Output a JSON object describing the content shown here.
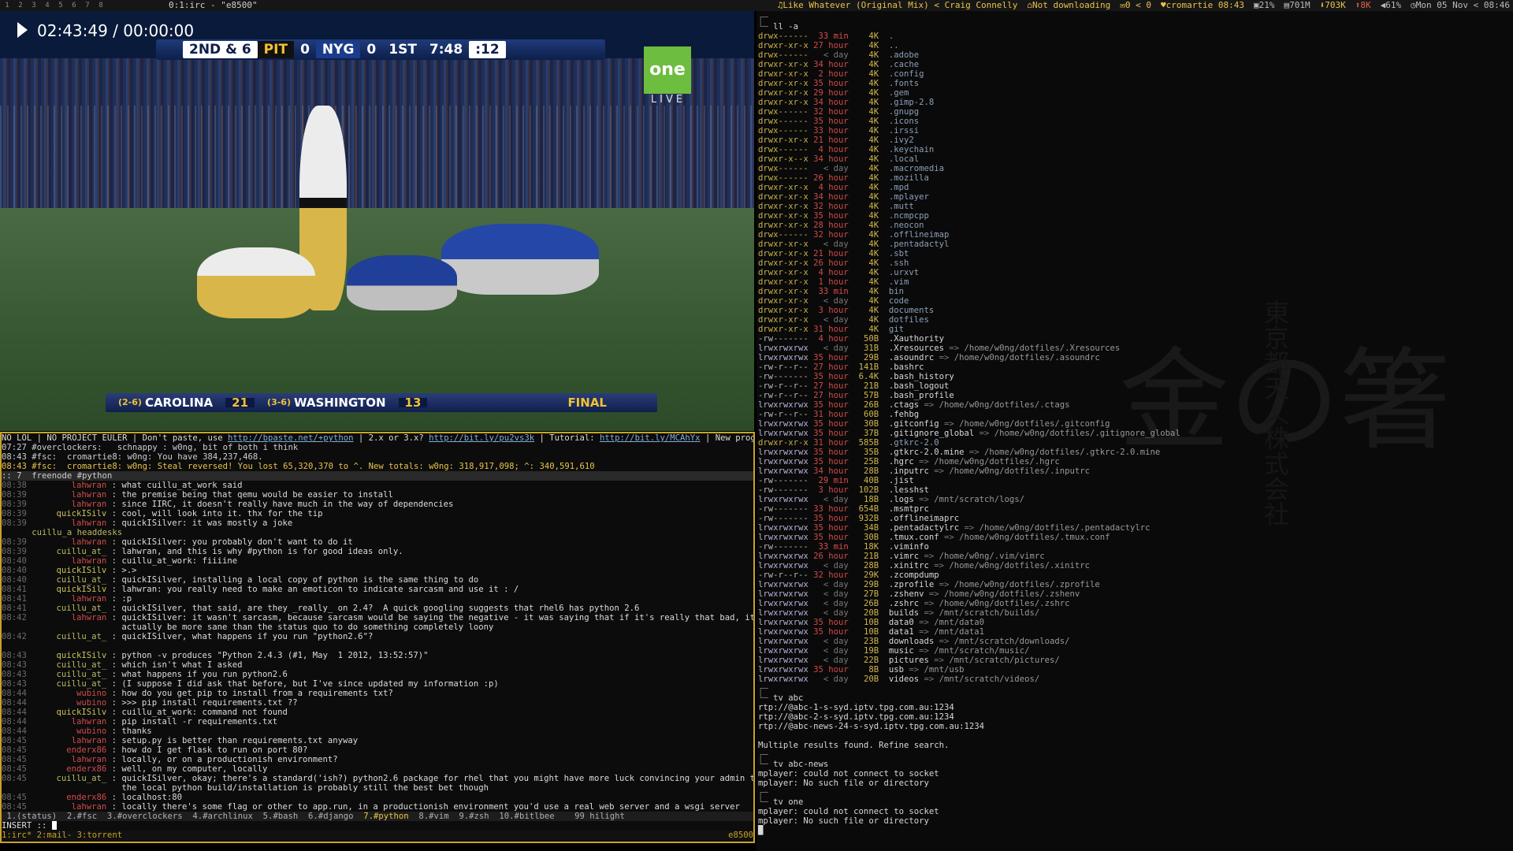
{
  "topbar": {
    "workspaces": [
      "1",
      "2",
      "3",
      "4",
      "5",
      "6",
      "7",
      "8"
    ],
    "title": "0:1:irc - \"e8500\"",
    "music": "Like Whatever (Original Mix) < Craig Connelly",
    "torrent": "Not downloading",
    "mail": "0 < 0",
    "host": "cromartie",
    "time_small": "08:43",
    "cpu": "21%",
    "mem": "701M",
    "down": "703K",
    "up": "8K",
    "vol": "61%",
    "date": "Mon 05 Nov < 08:46"
  },
  "video": {
    "osd_time": "02:43:49 / 00:00:00",
    "scorebug": {
      "down": "2ND & 6",
      "team1": "PIT",
      "score1": "0",
      "team2": "NYG",
      "score2": "0",
      "quarter": "1ST",
      "clock": "7:48",
      "playclock": ":12"
    },
    "network": "one",
    "network_sub": "LIVE",
    "ticker": {
      "rec1": "(2-6)",
      "team1": "CAROLINA",
      "score1": "21",
      "rec2": "(3-6)",
      "team2": "WASHINGTON",
      "score2": "13",
      "status": "FINAL"
    }
  },
  "irc": {
    "topic_pre": "NO LOL | NO PROJECT EULER | Don't paste, use ",
    "topic_link1": "http://bpaste.net/+python",
    "topic_mid": " | 2.x or 3.x? ",
    "topic_link2": "http://bit.ly/pu2vs3k",
    "topic_mid2": " | Tutorial: ",
    "topic_link3": "http://bit.ly/MCAhYx",
    "topic_post": " | New programmer?",
    "status_lines": [
      "07:27 #overclockers:   schnappy : w0ng, bit of both i think",
      "08:43 #fsc:  cromartie8: w0ng: You have 384,237,468.",
      "08:43 #fsc:  cromartie8: w0ng: Steal reversed! You lost 65,320,370 to ^. New totals: w0ng: 318,917,098; ^: 340,591,610"
    ],
    "channel_header": ":: 7  freenode #python",
    "messages": [
      {
        "t": "08:38",
        "nick": "lahwran",
        "c": "n-r",
        "msg": "what cuillu_at_work said"
      },
      {
        "t": "08:39",
        "nick": "lahwran",
        "c": "n-r",
        "msg": "the premise being that qemu would be easier to install"
      },
      {
        "t": "08:39",
        "nick": "lahwran",
        "c": "n-r",
        "msg": "since IIRC, it doesn't really have much in the way of dependencies"
      },
      {
        "t": "08:39",
        "nick": "quickISilv",
        "c": "n-g",
        "msg": "cool, will look into it. thx for the tip"
      },
      {
        "t": "08:39",
        "nick": "lahwran",
        "c": "n-r",
        "msg": "quickISilver: it was mostly a joke"
      },
      {
        "t": "",
        "nick": "cuillu_a headdesks",
        "c": "n-c",
        "msg": "",
        "action": true
      },
      {
        "t": "08:39",
        "nick": "lahwran",
        "c": "n-r",
        "msg": "quickISilver: you probably don't want to do it"
      },
      {
        "t": "08:39",
        "nick": "cuillu_at_",
        "c": "n-c",
        "msg": "lahwran, and this is why #python is for good ideas only."
      },
      {
        "t": "08:40",
        "nick": "lahwran",
        "c": "n-r",
        "msg": "cuillu_at_work: fiiiine"
      },
      {
        "t": "08:40",
        "nick": "quickISilv",
        "c": "n-g",
        "msg": ">.>"
      },
      {
        "t": "08:40",
        "nick": "cuillu_at_",
        "c": "n-c",
        "msg": "quickISilver, installing a local copy of python is the same thing to do"
      },
      {
        "t": "08:41",
        "nick": "quickISilv",
        "c": "n-g",
        "msg": "lahwran: you really need to make an emoticon to indicate sarcasm and use it : /"
      },
      {
        "t": "08:41",
        "nick": "lahwran",
        "c": "n-r",
        "msg": ":p"
      },
      {
        "t": "08:41",
        "nick": "cuillu_at_",
        "c": "n-c",
        "msg": "quickISilver, that said, are they _really_ on 2.4?  A quick googling suggests that rhel6 has python 2.6"
      },
      {
        "t": "08:42",
        "nick": "lahwran",
        "c": "n-r",
        "msg": "quickISilver: it wasn't sarcasm, because sarcasm would be saying the negative - it was saying that if it's really that bad, it might"
      },
      {
        "t": "",
        "nick": "",
        "c": "n-b",
        "msg": "actually be more sane than the status quo to do something completely loony"
      },
      {
        "t": "08:42",
        "nick": "cuillu_at_",
        "c": "n-c",
        "msg": "quickISilver, what happens if you run \"python2.6\"?"
      },
      {
        "t": "",
        "nick": "",
        "c": "n-b",
        "msg": ""
      },
      {
        "t": "08:43",
        "nick": "quickISilv",
        "c": "n-g",
        "msg": "python -v produces \"Python 2.4.3 (#1, May  1 2012, 13:52:57)\""
      },
      {
        "t": "08:43",
        "nick": "cuillu_at_",
        "c": "n-c",
        "msg": "which isn't what I asked"
      },
      {
        "t": "08:43",
        "nick": "cuillu_at_",
        "c": "n-c",
        "msg": "what happens if you run python2.6"
      },
      {
        "t": "08:43",
        "nick": "cuillu_at_",
        "c": "n-c",
        "msg": "(I suppose I did ask that before, but I've since updated my information :p)"
      },
      {
        "t": "08:44",
        "nick": "wubino",
        "c": "n-r",
        "msg": "how do you get pip to install from a requirements txt?"
      },
      {
        "t": "08:44",
        "nick": "wubino",
        "c": "n-r",
        "msg": ">>> pip install requirements.txt ??"
      },
      {
        "t": "08:44",
        "nick": "quickISilv",
        "c": "n-g",
        "msg": "cuillu_at_work: command not found"
      },
      {
        "t": "08:44",
        "nick": "lahwran",
        "c": "n-r",
        "msg": "pip install -r requirements.txt"
      },
      {
        "t": "08:44",
        "nick": "wubino",
        "c": "n-r",
        "msg": "thanks"
      },
      {
        "t": "08:45",
        "nick": "lahwran",
        "c": "n-r",
        "msg": "setup.py is better than requirements.txt anyway"
      },
      {
        "t": "08:45",
        "nick": "enderx86",
        "c": "n-r",
        "msg": "how do I get flask to run on port 80?"
      },
      {
        "t": "08:45",
        "nick": "lahwran",
        "c": "n-r",
        "msg": "locally, or on a productionish environment?"
      },
      {
        "t": "08:45",
        "nick": "enderx86",
        "c": "n-r",
        "msg": "well, on my computer, locally"
      },
      {
        "t": "08:45",
        "nick": "cuillu_at_",
        "c": "n-c",
        "msg": "quickISilver, okay; there's a standard('ish?) python2.6 package for rhel that you might have more luck convincing your admin to install;"
      },
      {
        "t": "",
        "nick": "",
        "c": "n-b",
        "msg": "the local python build/installation is probably still the best bet though"
      },
      {
        "t": "08:45",
        "nick": "enderx86",
        "c": "n-r",
        "msg": "localhost:80"
      },
      {
        "t": "08:45",
        "nick": "lahwran",
        "c": "n-r",
        "msg": "locally there's some flag or other to app.run, in a productionish environment you'd use a real web server and a wsgi server"
      }
    ],
    "windows_pre": " 1.(status)  2.#fsc  3.#overclockers  4.#archlinux  5.#bash  6.#django  ",
    "windows_active": "7.#python",
    "windows_post": "  8.#vim  9.#zsh  10.#bitlbee    99 hilight",
    "input_mode": "INSERT :: ",
    "tmux_left": "1:irc* 2:mail- 3:torrent",
    "tmux_right": "e8500"
  },
  "terminal": {
    "prompt_cmd": "ll -a",
    "listing": [
      [
        "drwx------",
        "33 min",
        "4K",
        "."
      ],
      [
        "drwxr-xr-x",
        "27 hour",
        "4K",
        ".."
      ],
      [
        "drwx------",
        "< day",
        "4K",
        ".adobe"
      ],
      [
        "drwxr-xr-x",
        "34 hour",
        "4K",
        ".cache"
      ],
      [
        "drwxr-xr-x",
        "2 hour",
        "4K",
        ".config"
      ],
      [
        "drwxr-xr-x",
        "35 hour",
        "4K",
        ".fonts"
      ],
      [
        "drwxr-xr-x",
        "29 hour",
        "4K",
        ".gem"
      ],
      [
        "drwxr-xr-x",
        "34 hour",
        "4K",
        ".gimp-2.8"
      ],
      [
        "drwx------",
        "32 hour",
        "4K",
        ".gnupg"
      ],
      [
        "drwx------",
        "35 hour",
        "4K",
        ".icons"
      ],
      [
        "drwx------",
        "33 hour",
        "4K",
        ".irssi"
      ],
      [
        "drwxr-xr-x",
        "21 hour",
        "4K",
        ".ivy2"
      ],
      [
        "drwx------",
        "4 hour",
        "4K",
        ".keychain"
      ],
      [
        "drwxr-x--x",
        "34 hour",
        "4K",
        ".local"
      ],
      [
        "drwx------",
        "< day",
        "4K",
        ".macromedia"
      ],
      [
        "drwx------",
        "26 hour",
        "4K",
        ".mozilla"
      ],
      [
        "drwxr-xr-x",
        "4 hour",
        "4K",
        ".mpd"
      ],
      [
        "drwxr-xr-x",
        "34 hour",
        "4K",
        ".mplayer"
      ],
      [
        "drwxr-xr-x",
        "32 hour",
        "4K",
        ".mutt"
      ],
      [
        "drwxr-xr-x",
        "35 hour",
        "4K",
        ".ncmpcpp"
      ],
      [
        "drwxr-xr-x",
        "28 hour",
        "4K",
        ".neocon"
      ],
      [
        "drwx------",
        "32 hour",
        "4K",
        ".offlineimap"
      ],
      [
        "drwxr-xr-x",
        "< day",
        "4K",
        ".pentadactyl"
      ],
      [
        "drwxr-xr-x",
        "21 hour",
        "4K",
        ".sbt"
      ],
      [
        "drwxr-xr-x",
        "26 hour",
        "4K",
        ".ssh"
      ],
      [
        "drwxr-xr-x",
        "4 hour",
        "4K",
        ".urxvt"
      ],
      [
        "drwxr-xr-x",
        "1 hour",
        "4K",
        ".vim"
      ],
      [
        "drwxr-xr-x",
        "33 min",
        "4K",
        "bin"
      ],
      [
        "drwxr-xr-x",
        "< day",
        "4K",
        "code"
      ],
      [
        "drwxr-xr-x",
        "3 hour",
        "4K",
        "documents"
      ],
      [
        "drwxr-xr-x",
        "< day",
        "4K",
        "dotfiles"
      ],
      [
        "drwxr-xr-x",
        "31 hour",
        "4K",
        "git"
      ],
      [
        "-rw-------",
        "4 hour",
        "50B",
        ".Xauthority"
      ],
      [
        "lrwxrwxrwx",
        "< day",
        "31B",
        ".Xresources => /home/w0ng/dotfiles/.Xresources"
      ],
      [
        "lrwxrwxrwx",
        "35 hour",
        "29B",
        ".asoundrc => /home/w0ng/dotfiles/.asoundrc"
      ],
      [
        "-rw-r--r--",
        "27 hour",
        "141B",
        ".bashrc"
      ],
      [
        "-rw-------",
        "35 hour",
        "6.4K",
        ".bash_history"
      ],
      [
        "-rw-r--r--",
        "27 hour",
        "21B",
        ".bash_logout"
      ],
      [
        "-rw-r--r--",
        "27 hour",
        "57B",
        ".bash_profile"
      ],
      [
        "lrwxrwxrwx",
        "35 hour",
        "26B",
        ".ctags => /home/w0ng/dotfiles/.ctags"
      ],
      [
        "-rw-r--r--",
        "31 hour",
        "60B",
        ".fehbg"
      ],
      [
        "lrwxrwxrwx",
        "35 hour",
        "30B",
        ".gitconfig => /home/w0ng/dotfiles/.gitconfig"
      ],
      [
        "lrwxrwxrwx",
        "35 hour",
        "37B",
        ".gitignore_global => /home/w0ng/dotfiles/.gitignore_global"
      ],
      [
        "drwxr-xr-x",
        "31 hour",
        "585B",
        ".gtkrc-2.0"
      ],
      [
        "lrwxrwxrwx",
        "35 hour",
        "35B",
        ".gtkrc-2.0.mine => /home/w0ng/dotfiles/.gtkrc-2.0.mine"
      ],
      [
        "lrwxrwxrwx",
        "35 hour",
        "25B",
        ".hgrc => /home/w0ng/dotfiles/.hgrc"
      ],
      [
        "lrwxrwxrwx",
        "34 hour",
        "28B",
        ".inputrc => /home/w0ng/dotfiles/.inputrc"
      ],
      [
        "-rw-------",
        "29 min",
        "40B",
        ".jist"
      ],
      [
        "-rw-------",
        "3 hour",
        "102B",
        ".lesshst"
      ],
      [
        "lrwxrwxrwx",
        "< day",
        "18B",
        ".logs => /mnt/scratch/logs/"
      ],
      [
        "-rw-------",
        "33 hour",
        "654B",
        ".msmtprc"
      ],
      [
        "-rw-------",
        "35 hour",
        "932B",
        ".offlineimaprc"
      ],
      [
        "lrwxrwxrwx",
        "35 hour",
        "34B",
        ".pentadactylrc => /home/w0ng/dotfiles/.pentadactylrc"
      ],
      [
        "lrwxrwxrwx",
        "35 hour",
        "30B",
        ".tmux.conf => /home/w0ng/dotfiles/.tmux.conf"
      ],
      [
        "-rw-------",
        "33 min",
        "18K",
        ".viminfo"
      ],
      [
        "lrwxrwxrwx",
        "26 hour",
        "21B",
        ".vimrc => /home/w0ng/.vim/vimrc"
      ],
      [
        "lrwxrwxrwx",
        "< day",
        "28B",
        ".xinitrc => /home/w0ng/dotfiles/.xinitrc"
      ],
      [
        "-rw-r--r--",
        "32 hour",
        "29K",
        ".zcompdump"
      ],
      [
        "lrwxrwxrwx",
        "< day",
        "29B",
        ".zprofile => /home/w0ng/dotfiles/.zprofile"
      ],
      [
        "lrwxrwxrwx",
        "< day",
        "27B",
        ".zshenv => /home/w0ng/dotfiles/.zshenv"
      ],
      [
        "lrwxrwxrwx",
        "< day",
        "26B",
        ".zshrc => /home/w0ng/dotfiles/.zshrc"
      ],
      [
        "lrwxrwxrwx",
        "< day",
        "20B",
        "builds => /mnt/scratch/builds/"
      ],
      [
        "lrwxrwxrwx",
        "35 hour",
        "10B",
        "data0 => /mnt/data0"
      ],
      [
        "lrwxrwxrwx",
        "35 hour",
        "10B",
        "data1 => /mnt/data1"
      ],
      [
        "lrwxrwxrwx",
        "< day",
        "23B",
        "downloads => /mnt/scratch/downloads/"
      ],
      [
        "lrwxrwxrwx",
        "< day",
        "19B",
        "music => /mnt/scratch/music/"
      ],
      [
        "lrwxrwxrwx",
        "< day",
        "22B",
        "pictures => /mnt/scratch/pictures/"
      ],
      [
        "lrwxrwxrwx",
        "35 hour",
        "8B",
        "usb => /mnt/usb"
      ],
      [
        "lrwxrwxrwx",
        "< day",
        "20B",
        "videos => /mnt/scratch/videos/"
      ]
    ],
    "cmd2": "tv abc",
    "out2": [
      "rtp://@abc-1-s-syd.iptv.tpg.com.au:1234",
      "rtp://@abc-2-s-syd.iptv.tpg.com.au:1234",
      "rtp://@abc-news-24-s-syd.iptv.tpg.com.au:1234",
      "",
      "Multiple results found. Refine search."
    ],
    "cmd3": "tv abc-news",
    "out3": [
      "mplayer: could not connect to socket",
      "mplayer: No such file or directory"
    ],
    "cmd4": "tv one",
    "out4": [
      "mplayer: could not connect to socket",
      "mplayer: No such file or directory"
    ],
    "wallpaper_text": "金の箸",
    "wallpaper_text2": "東京都天〈株式会社"
  }
}
